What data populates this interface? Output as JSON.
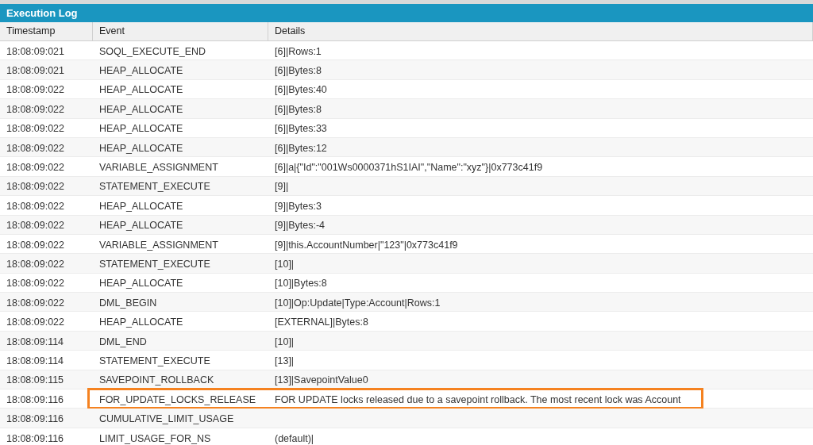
{
  "panel": {
    "title": "Execution Log"
  },
  "table": {
    "columns": [
      "Timestamp",
      "Event",
      "Details"
    ],
    "rows": [
      {
        "cells": [
          "18:08:09:021",
          "SOQL_EXECUTE_END",
          "[6]|Rows:1"
        ],
        "highlighted": false
      },
      {
        "cells": [
          "18:08:09:021",
          "HEAP_ALLOCATE",
          "[6]|Bytes:8"
        ],
        "highlighted": false
      },
      {
        "cells": [
          "18:08:09:022",
          "HEAP_ALLOCATE",
          "[6]|Bytes:40"
        ],
        "highlighted": false
      },
      {
        "cells": [
          "18:08:09:022",
          "HEAP_ALLOCATE",
          "[6]|Bytes:8"
        ],
        "highlighted": false
      },
      {
        "cells": [
          "18:08:09:022",
          "HEAP_ALLOCATE",
          "[6]|Bytes:33"
        ],
        "highlighted": false
      },
      {
        "cells": [
          "18:08:09:022",
          "HEAP_ALLOCATE",
          "[6]|Bytes:12"
        ],
        "highlighted": false
      },
      {
        "cells": [
          "18:08:09:022",
          "VARIABLE_ASSIGNMENT",
          "[6]|a|{\"Id\":\"001Ws0000371hS1IAI\",\"Name\":\"xyz\"}|0x773c41f9"
        ],
        "highlighted": false
      },
      {
        "cells": [
          "18:08:09:022",
          "STATEMENT_EXECUTE",
          "[9]|"
        ],
        "highlighted": false
      },
      {
        "cells": [
          "18:08:09:022",
          "HEAP_ALLOCATE",
          "[9]|Bytes:3"
        ],
        "highlighted": false
      },
      {
        "cells": [
          "18:08:09:022",
          "HEAP_ALLOCATE",
          "[9]|Bytes:-4"
        ],
        "highlighted": false
      },
      {
        "cells": [
          "18:08:09:022",
          "VARIABLE_ASSIGNMENT",
          "[9]|this.AccountNumber|\"123\"|0x773c41f9"
        ],
        "highlighted": false
      },
      {
        "cells": [
          "18:08:09:022",
          "STATEMENT_EXECUTE",
          "[10]|"
        ],
        "highlighted": false
      },
      {
        "cells": [
          "18:08:09:022",
          "HEAP_ALLOCATE",
          "[10]|Bytes:8"
        ],
        "highlighted": false
      },
      {
        "cells": [
          "18:08:09:022",
          "DML_BEGIN",
          "[10]|Op:Update|Type:Account|Rows:1"
        ],
        "highlighted": false
      },
      {
        "cells": [
          "18:08:09:022",
          "HEAP_ALLOCATE",
          "[EXTERNAL]|Bytes:8"
        ],
        "highlighted": false
      },
      {
        "cells": [
          "18:08:09:114",
          "DML_END",
          "[10]|"
        ],
        "highlighted": false
      },
      {
        "cells": [
          "18:08:09:114",
          "STATEMENT_EXECUTE",
          "[13]|"
        ],
        "highlighted": false
      },
      {
        "cells": [
          "18:08:09:115",
          "SAVEPOINT_ROLLBACK",
          "[13]|SavepointValue0"
        ],
        "highlighted": false
      },
      {
        "cells": [
          "18:08:09:116",
          "FOR_UPDATE_LOCKS_RELEASE",
          "FOR UPDATE locks released due to a savepoint rollback. The most recent lock was Account"
        ],
        "highlighted": true
      },
      {
        "cells": [
          "18:08:09:116",
          "CUMULATIVE_LIMIT_USAGE"
        ],
        "highlighted": false
      },
      {
        "cells": [
          "18:08:09:116",
          "LIMIT_USAGE_FOR_NS",
          "(default)|"
        ],
        "highlighted": false
      }
    ]
  }
}
